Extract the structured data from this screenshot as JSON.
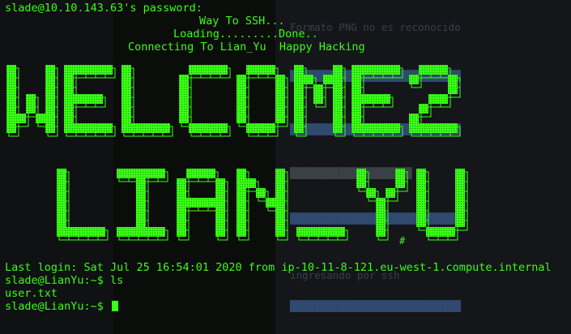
{
  "terminal": {
    "password_prompt": "slade@10.10.143.63's password:",
    "motd_line1": "Way To SSH...",
    "motd_line2": "Loading.........Done..",
    "motd_line3": "Connecting To Lian_Yu  Happy Hacking",
    "banner_line1": "WELCOME2",
    "banner_line2": "LIAN_YU",
    "banner_hash": "#",
    "last_login": "Last login: Sat Jul 25 16:54:01 2020 from ip-10-11-8-121.eu-west-1.compute.internal",
    "prompt1": "slade@LianYu:~$ ls",
    "ls_output": "user.txt",
    "prompt2": "slade@LianYu:~$ "
  },
  "colors": {
    "terminal_green": "#39ff14",
    "background": "#0b0d0b"
  },
  "background_window": {
    "line1": "Formato PNG no es reconocido",
    "line2": "ingresando por ssh"
  }
}
